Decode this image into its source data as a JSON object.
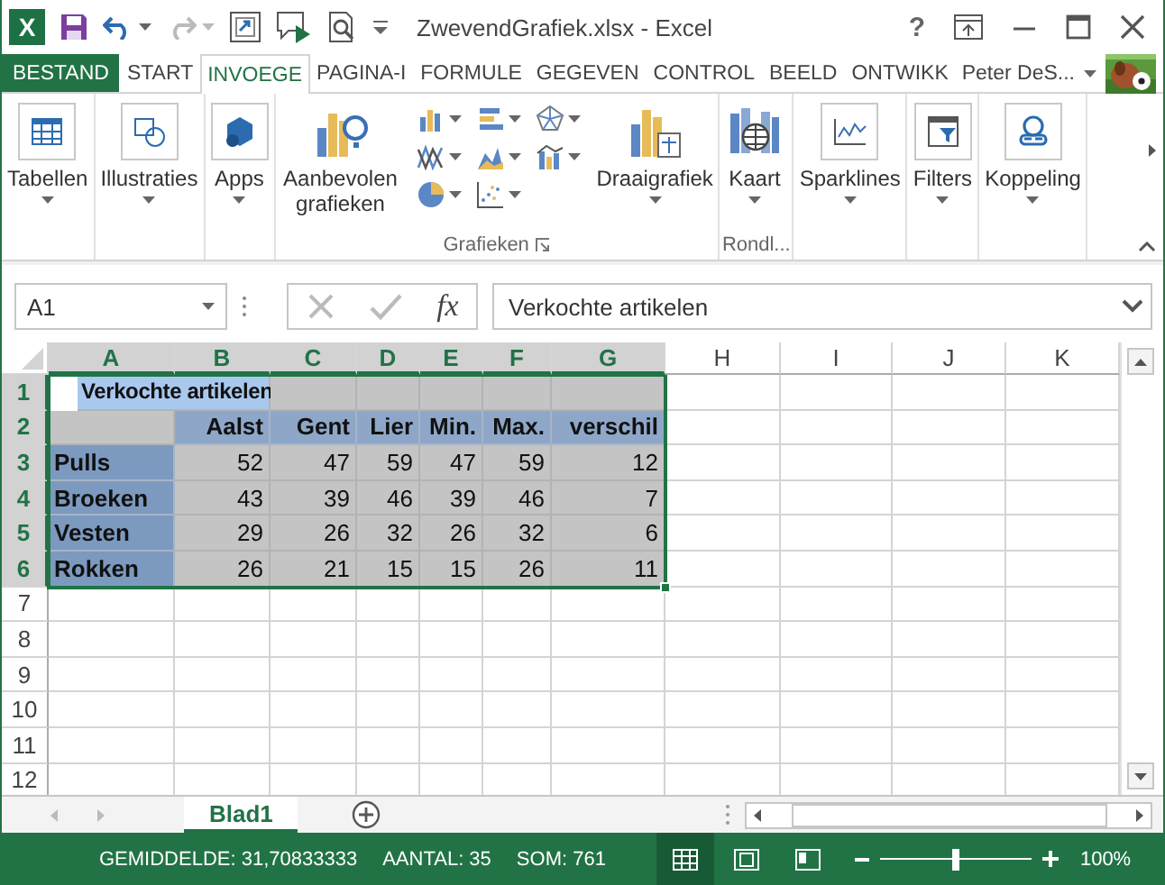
{
  "window": {
    "logo_text": "X",
    "title": "ZwevendGrafiek.xlsx - Excel",
    "help": "?"
  },
  "tabs": [
    {
      "label": "BESTAND",
      "kind": "file",
      "selected": false
    },
    {
      "label": "START",
      "kind": "tab",
      "selected": false
    },
    {
      "label": "INVOEGE",
      "kind": "tab",
      "selected": true
    },
    {
      "label": "PAGINA-I",
      "kind": "tab",
      "selected": false
    },
    {
      "label": "FORMULE",
      "kind": "tab",
      "selected": false
    },
    {
      "label": "GEGEVEN",
      "kind": "tab",
      "selected": false
    },
    {
      "label": "CONTROL",
      "kind": "tab",
      "selected": false
    },
    {
      "label": "BEELD",
      "kind": "tab",
      "selected": false
    },
    {
      "label": "ONTWIKK",
      "kind": "tab",
      "selected": false
    }
  ],
  "user": {
    "name": "Peter DeS..."
  },
  "ribbon": {
    "groups": [
      {
        "gallery": false,
        "items": [
          {
            "label": "Tabellen",
            "menu": true
          }
        ]
      },
      {
        "gallery": false,
        "items": [
          {
            "label": "Illustraties",
            "menu": true
          }
        ]
      },
      {
        "gallery": false,
        "items": [
          {
            "label": "Apps",
            "menu": true
          }
        ]
      },
      {
        "label": "Grafieken",
        "gallery": true,
        "items": [
          {
            "label": "Aanbevolen grafieken",
            "menu": false
          },
          {
            "label": "Draaigrafiek",
            "menu": true
          }
        ]
      },
      {
        "label": "Rondl...",
        "gallery": false,
        "items": [
          {
            "label": "Kaart",
            "menu": true
          }
        ]
      },
      {
        "gallery": false,
        "items": [
          {
            "label": "Sparklines",
            "menu": true
          }
        ]
      },
      {
        "gallery": false,
        "items": [
          {
            "label": "Filters",
            "menu": true
          }
        ]
      },
      {
        "gallery": false,
        "items": [
          {
            "label": "Koppeling",
            "menu": true
          }
        ]
      }
    ]
  },
  "formula_bar": {
    "name_box": "A1",
    "function_label": "fx",
    "value": "Verkochte artikelen"
  },
  "columns": [
    {
      "label": "A",
      "selected": true
    },
    {
      "label": "B",
      "selected": true
    },
    {
      "label": "C",
      "selected": true
    },
    {
      "label": "D",
      "selected": true
    },
    {
      "label": "E",
      "selected": true
    },
    {
      "label": "F",
      "selected": true
    },
    {
      "label": "G",
      "selected": true
    },
    {
      "label": "H",
      "selected": false
    },
    {
      "label": "I",
      "selected": false
    },
    {
      "label": "J",
      "selected": false
    },
    {
      "label": "K",
      "selected": false
    }
  ],
  "rows": [
    {
      "label": "1",
      "selected": true,
      "cells": [
        {
          "kind": "title",
          "text": "Verkochte artikelen"
        },
        {
          "kind": "fill"
        },
        {
          "kind": "fill"
        },
        {
          "kind": "fill"
        },
        {
          "kind": "fill"
        },
        {
          "kind": "fill"
        }
      ]
    },
    {
      "label": "2",
      "selected": true,
      "cells": [
        {
          "kind": "fill"
        },
        {
          "kind": "header",
          "text": "Aalst"
        },
        {
          "kind": "header",
          "text": "Gent"
        },
        {
          "kind": "header",
          "text": "Lier"
        },
        {
          "kind": "header",
          "text": "Min."
        },
        {
          "kind": "header",
          "text": "Max."
        },
        {
          "kind": "header",
          "text": "verschil"
        }
      ]
    },
    {
      "label": "3",
      "selected": true,
      "cells": [
        {
          "kind": "label",
          "text": "Pulls"
        },
        {
          "kind": "value",
          "text": "52"
        },
        {
          "kind": "value",
          "text": "47"
        },
        {
          "kind": "value",
          "text": "59"
        },
        {
          "kind": "value",
          "text": "47"
        },
        {
          "kind": "value",
          "text": "59"
        },
        {
          "kind": "value",
          "text": "12"
        }
      ]
    },
    {
      "label": "4",
      "selected": true,
      "cells": [
        {
          "kind": "label",
          "text": "Broeken"
        },
        {
          "kind": "value",
          "text": "43"
        },
        {
          "kind": "value",
          "text": "39"
        },
        {
          "kind": "value",
          "text": "46"
        },
        {
          "kind": "value",
          "text": "39"
        },
        {
          "kind": "value",
          "text": "46"
        },
        {
          "kind": "value",
          "text": "7"
        }
      ]
    },
    {
      "label": "5",
      "selected": true,
      "cells": [
        {
          "kind": "label",
          "text": "Vesten"
        },
        {
          "kind": "value",
          "text": "29"
        },
        {
          "kind": "value",
          "text": "26"
        },
        {
          "kind": "value",
          "text": "32"
        },
        {
          "kind": "value",
          "text": "26"
        },
        {
          "kind": "value",
          "text": "32"
        },
        {
          "kind": "value",
          "text": "6"
        }
      ]
    },
    {
      "label": "6",
      "selected": true,
      "cells": [
        {
          "kind": "label",
          "text": "Rokken"
        },
        {
          "kind": "value",
          "text": "26"
        },
        {
          "kind": "value",
          "text": "21"
        },
        {
          "kind": "value",
          "text": "15"
        },
        {
          "kind": "value",
          "text": "15"
        },
        {
          "kind": "value",
          "text": "26"
        },
        {
          "kind": "value",
          "text": "11"
        }
      ]
    },
    {
      "label": "7",
      "selected": false
    },
    {
      "label": "8",
      "selected": false
    },
    {
      "label": "9",
      "selected": false
    },
    {
      "label": "10",
      "selected": false
    },
    {
      "label": "11",
      "selected": false
    },
    {
      "label": "12",
      "selected": false
    }
  ],
  "sheet_tabs": [
    {
      "label": "Blad1",
      "selected": true
    }
  ],
  "status_bar": {
    "stats": [
      "GEMIDDELDE: 31,70833333",
      "AANTAL: 35",
      "SOM: 761"
    ],
    "views": [
      {
        "selected": true
      },
      {
        "selected": false
      },
      {
        "selected": false
      }
    ],
    "zoom": {
      "level": 0.5,
      "label": "100%"
    }
  }
}
